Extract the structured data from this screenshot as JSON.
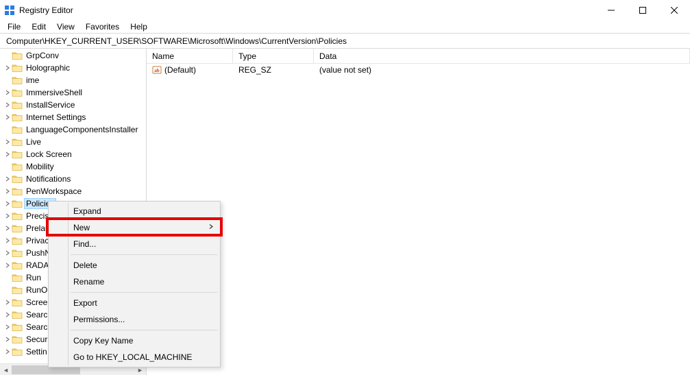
{
  "window": {
    "title": "Registry Editor"
  },
  "menubar": {
    "file": "File",
    "edit": "Edit",
    "view": "View",
    "favorites": "Favorites",
    "help": "Help"
  },
  "address": {
    "path": "Computer\\HKEY_CURRENT_USER\\SOFTWARE\\Microsoft\\Windows\\CurrentVersion\\Policies"
  },
  "tree": {
    "items": [
      {
        "label": "GrpConv",
        "children": false
      },
      {
        "label": "Holographic",
        "children": true
      },
      {
        "label": "ime",
        "children": false
      },
      {
        "label": "ImmersiveShell",
        "children": true
      },
      {
        "label": "InstallService",
        "children": true
      },
      {
        "label": "Internet Settings",
        "children": true
      },
      {
        "label": "LanguageComponentsInstaller",
        "children": false
      },
      {
        "label": "Live",
        "children": true
      },
      {
        "label": "Lock Screen",
        "children": true
      },
      {
        "label": "Mobility",
        "children": false
      },
      {
        "label": "Notifications",
        "children": true
      },
      {
        "label": "PenWorkspace",
        "children": true
      },
      {
        "label": "Policies",
        "children": true,
        "selected": true
      },
      {
        "label": "PrecisionTouchPad",
        "children": true,
        "truncated": "Precis"
      },
      {
        "label": "Prelaunch",
        "children": true,
        "truncated": "Prelau"
      },
      {
        "label": "Privacy",
        "children": true,
        "truncated": "Privac"
      },
      {
        "label": "PushNotifications",
        "children": true,
        "truncated": "PushN"
      },
      {
        "label": "RADAR",
        "children": true,
        "truncated": "RADA"
      },
      {
        "label": "Run",
        "children": false,
        "truncated": "Run"
      },
      {
        "label": "RunOnce",
        "children": false,
        "truncated": "RunO"
      },
      {
        "label": "Screensavers",
        "children": true,
        "truncated": "Scree"
      },
      {
        "label": "Search",
        "children": true,
        "truncated": "Searc"
      },
      {
        "label": "SearchSettings",
        "children": true,
        "truncated": "Searc"
      },
      {
        "label": "Security and Maintenance",
        "children": true,
        "truncated": "Secur"
      },
      {
        "label": "SettingsPage",
        "children": true,
        "truncated": "Settin"
      }
    ]
  },
  "values": {
    "headers": {
      "name": "Name",
      "type": "Type",
      "data": "Data"
    },
    "rows": [
      {
        "icon": "ab",
        "name": "(Default)",
        "type": "REG_SZ",
        "data": "(value not set)"
      }
    ]
  },
  "context_menu": {
    "items": [
      {
        "label": "Expand",
        "kind": "item",
        "highlighted": false
      },
      {
        "label": "New",
        "kind": "submenu",
        "highlighted": true
      },
      {
        "label": "Find...",
        "kind": "item"
      },
      {
        "kind": "sep"
      },
      {
        "label": "Delete",
        "kind": "item"
      },
      {
        "label": "Rename",
        "kind": "item"
      },
      {
        "kind": "sep"
      },
      {
        "label": "Export",
        "kind": "item"
      },
      {
        "label": "Permissions...",
        "kind": "item"
      },
      {
        "kind": "sep"
      },
      {
        "label": "Copy Key Name",
        "kind": "item"
      },
      {
        "label": "Go to HKEY_LOCAL_MACHINE",
        "kind": "item"
      }
    ]
  }
}
